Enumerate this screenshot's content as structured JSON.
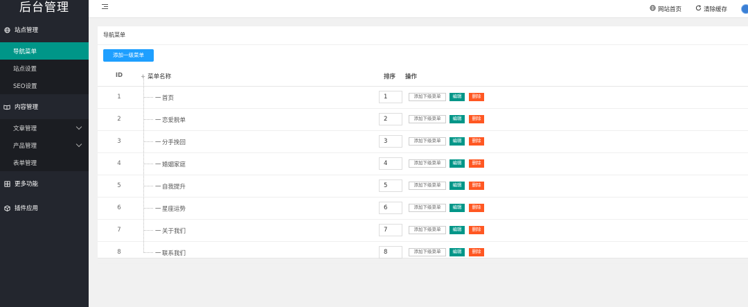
{
  "sidebar": {
    "logo": "后台管理",
    "groups": [
      {
        "label": "站点管理",
        "icon": "globe-icon"
      },
      {
        "label": "内容管理",
        "icon": "reading-icon"
      },
      {
        "label": "更多功能",
        "icon": "app-icon"
      },
      {
        "label": "插件应用",
        "icon": "cube-icon"
      }
    ],
    "site_items": [
      {
        "label": "导航菜单",
        "active": true
      },
      {
        "label": "站点设置"
      },
      {
        "label": "SEO设置"
      }
    ],
    "content_items": [
      {
        "label": "文章管理"
      },
      {
        "label": "产品管理"
      },
      {
        "label": "表单管理"
      }
    ]
  },
  "header": {
    "toggle_icon": "menu-fold-icon",
    "site_home": "网站首页",
    "clear_cache": "清除缓存"
  },
  "card": {
    "title": "导航菜单",
    "add_button": "添加一级菜单"
  },
  "table": {
    "headers": {
      "id": "ID",
      "expand": "+",
      "name": "菜单名称",
      "sort": "排序",
      "ops": "操作"
    },
    "rows": [
      {
        "id": "1",
        "name": "首页",
        "sort": "1"
      },
      {
        "id": "2",
        "name": "恋爱脱单",
        "sort": "2"
      },
      {
        "id": "3",
        "name": "分手挽回",
        "sort": "3"
      },
      {
        "id": "4",
        "name": "婚姻家庭",
        "sort": "4"
      },
      {
        "id": "5",
        "name": "自我提升",
        "sort": "5"
      },
      {
        "id": "6",
        "name": "星座运势",
        "sort": "6"
      },
      {
        "id": "7",
        "name": "关于我们",
        "sort": "7"
      },
      {
        "id": "8",
        "name": "联系我们",
        "sort": "8"
      }
    ],
    "tree_dash": "一",
    "add_sub_label": "添加下级菜单",
    "edit_label": "编辑",
    "delete_label": "删除"
  },
  "colors": {
    "sidebar_bg": "#23262e",
    "active": "#009688",
    "primary_blue": "#1e9fff",
    "danger": "#ff5722"
  }
}
